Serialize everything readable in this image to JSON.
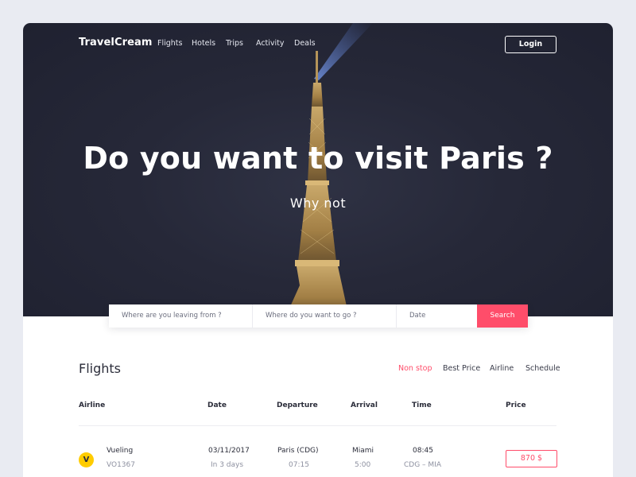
{
  "brand": "TravelCream",
  "nav": {
    "links": [
      "Flights",
      "Hotels",
      "Trips",
      "Activity",
      "Deals"
    ],
    "login_label": "Login"
  },
  "hero": {
    "headline": "Do you want to visit Paris ?",
    "subline": "Why not"
  },
  "search": {
    "from_placeholder": "Where are you leaving from ?",
    "to_placeholder": "Where do you want to go ?",
    "date_placeholder": "Date",
    "button_label": "Search"
  },
  "flights": {
    "title": "Flights",
    "filters": [
      "Non stop",
      "Best Price",
      "Airline",
      "Schedule"
    ],
    "active_filter": "Non stop",
    "columns": [
      "Airline",
      "Date",
      "Departure",
      "Arrival",
      "Time",
      "Price"
    ],
    "rows": [
      {
        "airline": "Vueling",
        "airline_logo": "V",
        "flight_no": "VO1367",
        "date": "03/11/2017",
        "date_note": "In 3 days",
        "departure": "Paris (CDG)",
        "departure_time": "07:15",
        "arrival": "Miami",
        "arrival_time": "5:00",
        "time": "08:45",
        "route": "CDG – MIA",
        "price": "870 $"
      }
    ]
  },
  "colors": {
    "accent": "#ff4d6a",
    "hero_bg": "#262838",
    "page_bg": "#e9ebf2"
  }
}
